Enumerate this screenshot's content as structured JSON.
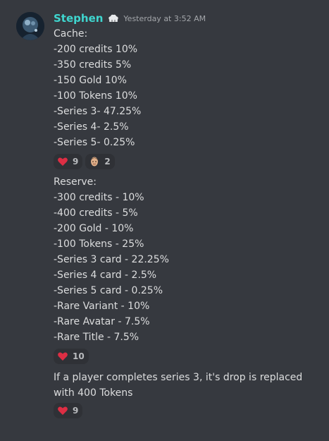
{
  "author": {
    "name": "Stephen",
    "timestamp": "Yesterday at 3:52 AM",
    "badge_icon": "chef-hat-icon"
  },
  "cache": {
    "lines": [
      "Cache:",
      "-200 credits 10%",
      "-350 credits 5%",
      "-150 Gold 10%",
      "-100 Tokens 10%",
      "-Series 3- 47.25%",
      "-Series 4- 2.5%",
      "-Series 5- 0.25%"
    ],
    "reactions": [
      {
        "emoji": "heart-icon",
        "count": "9"
      },
      {
        "emoji": "face-emoji",
        "count": "2"
      }
    ]
  },
  "reserve": {
    "lines": [
      "Reserve:",
      "-300 credits - 10%",
      "-400 credits - 5%",
      "-200 Gold - 10%",
      "-100 Tokens - 25%",
      "-Series 3 card - 22.25%",
      "-Series 4 card - 2.5%",
      "-Series 5 card - 0.25%",
      "-Rare Variant - 10%",
      "-Rare Avatar - 7.5%",
      "-Rare Title - 7.5%"
    ],
    "reactions": [
      {
        "emoji": "heart-icon",
        "count": "10"
      }
    ]
  },
  "note": {
    "text": "If a player completes series 3, it's drop is replaced with 400 Tokens",
    "reactions": [
      {
        "emoji": "heart-icon",
        "count": "9"
      }
    ]
  },
  "colors": {
    "background": "#36393f",
    "username": "#3fd6cf",
    "reaction_bg": "#2f3136",
    "heart": "#dd2e44"
  }
}
